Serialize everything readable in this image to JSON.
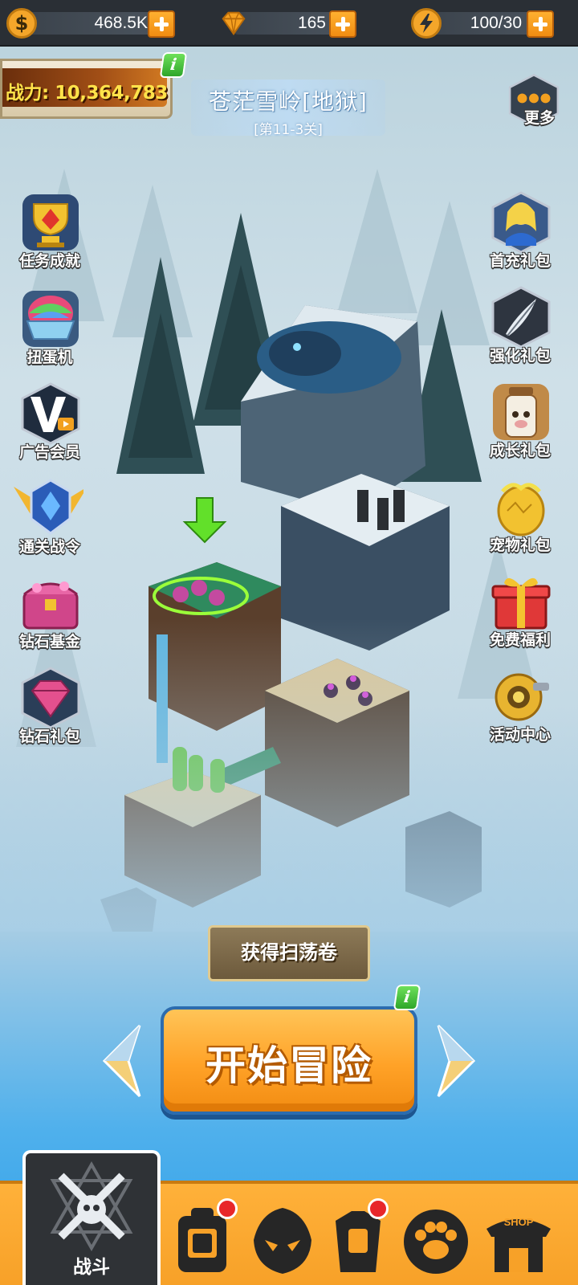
{
  "resources": {
    "gold": {
      "value": "468.5K",
      "icon": "dollar-coin-icon"
    },
    "diamond": {
      "value": "165",
      "icon": "diamond-icon"
    },
    "energy": {
      "value": "100/30",
      "icon": "lightning-icon"
    }
  },
  "power": {
    "label": "战力: 10,364,783"
  },
  "stage": {
    "title": "苍茫雪岭[地狱]",
    "subtitle": "[第11-3关]"
  },
  "left_buttons": [
    {
      "label": "任务成就",
      "icon": "trophy-icon"
    },
    {
      "label": "扭蛋机",
      "icon": "gacha-egg-icon"
    },
    {
      "label": "广告会员",
      "icon": "vip-video-icon"
    },
    {
      "label": "通关战令",
      "icon": "winged-crest-icon"
    },
    {
      "label": "钻石基金",
      "icon": "gem-chest-icon"
    },
    {
      "label": "钻石礼包",
      "icon": "gem-pack-icon"
    }
  ],
  "right_buttons": [
    {
      "label": "更多",
      "icon": "more-icon"
    },
    {
      "label": "首充礼包",
      "icon": "hero-portrait-icon"
    },
    {
      "label": "强化礼包",
      "icon": "feather-emblem-icon"
    },
    {
      "label": "成长礼包",
      "icon": "milk-bottle-icon"
    },
    {
      "label": "宠物礼包",
      "icon": "golden-egg-icon"
    },
    {
      "label": "免费福利",
      "icon": "gift-box-icon"
    },
    {
      "label": "活动中心",
      "icon": "golden-gear-icon"
    }
  ],
  "actions": {
    "sweep": "获得扫荡卷",
    "start": "开始冒险"
  },
  "badge_glyph": "i",
  "nav": {
    "active_label": "战斗",
    "items": [
      {
        "icon": "crossed-swords-icon"
      },
      {
        "icon": "backpack-icon",
        "notification": true
      },
      {
        "icon": "hero-mask-icon",
        "notification": false
      },
      {
        "icon": "armor-icon",
        "notification": true
      },
      {
        "icon": "paw-icon",
        "notification": false
      },
      {
        "icon": "shop-icon",
        "label": "SHOP",
        "notification": false
      }
    ]
  },
  "colors": {
    "topbar": "#2a2f35",
    "accent_orange": "#f7a128",
    "power_text": "#ffe34a",
    "badge_green": "#2ea62a",
    "notification_red": "#e8262a"
  }
}
